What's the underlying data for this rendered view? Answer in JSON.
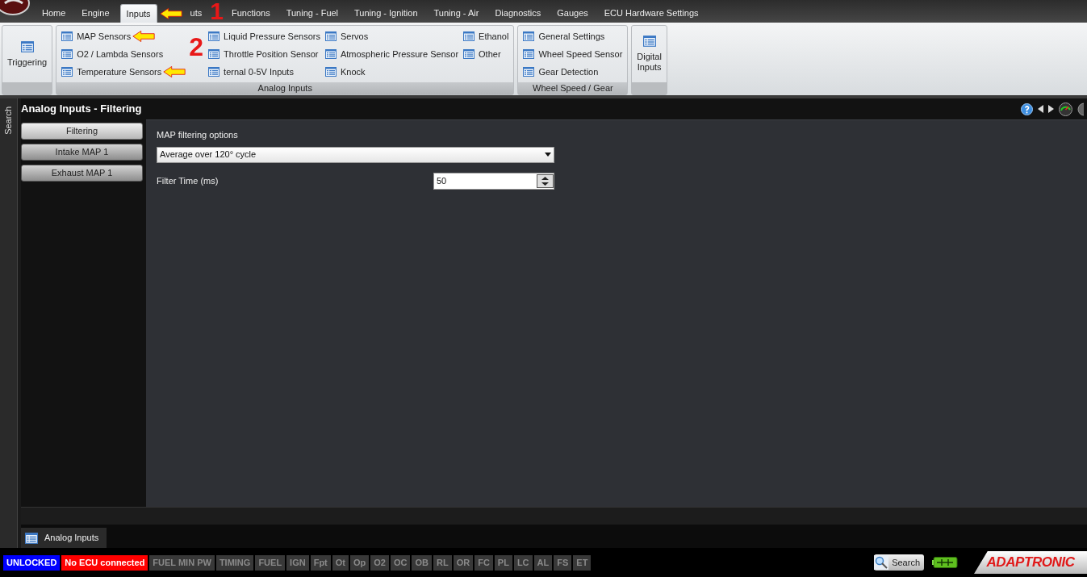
{
  "menu_tabs": [
    {
      "label": "Home",
      "selected": false
    },
    {
      "label": "Engine",
      "selected": false
    },
    {
      "label": "Inputs",
      "selected": true
    },
    {
      "label": "uts",
      "selected": false,
      "annotation": "1"
    },
    {
      "label": "Functions",
      "selected": false
    },
    {
      "label": "Tuning - Fuel",
      "selected": false
    },
    {
      "label": "Tuning - Ignition",
      "selected": false
    },
    {
      "label": "Tuning - Air",
      "selected": false
    },
    {
      "label": "Diagnostics",
      "selected": false
    },
    {
      "label": "Gauges",
      "selected": false
    },
    {
      "label": "ECU Hardware Settings",
      "selected": false
    }
  ],
  "ribbon": [
    {
      "kind": "large",
      "items": [
        {
          "label": "Triggering"
        }
      ]
    },
    {
      "kind": "columns",
      "title": "Analog Inputs",
      "columns": [
        {
          "annotation": "2",
          "items": [
            {
              "label": "MAP Sensors",
              "arrow": true
            },
            {
              "label": "O2 / Lambda Sensors",
              "arrow": false
            },
            {
              "label": "Temperature Sensors",
              "arrow": true
            }
          ]
        },
        {
          "items": [
            {
              "label": "Liquid Pressure Sensors",
              "arrow": false
            },
            {
              "label": "Throttle Position Sensor",
              "arrow": false
            },
            {
              "label": "ternal 0-5V Inputs",
              "arrow": false
            }
          ]
        },
        {
          "items": [
            {
              "label": "Servos",
              "arrow": false
            },
            {
              "label": "Atmospheric Pressure Sensor",
              "arrow": false
            },
            {
              "label": "Knock",
              "arrow": false
            }
          ]
        },
        {
          "items": [
            {
              "label": "Ethanol",
              "arrow": false
            },
            {
              "label": "Other",
              "arrow": false
            }
          ]
        }
      ]
    },
    {
      "kind": "columns",
      "title": "Wheel Speed / Gear",
      "columns": [
        {
          "items": [
            {
              "label": "General Settings",
              "arrow": false
            },
            {
              "label": "Wheel Speed Sensor",
              "arrow": false
            },
            {
              "label": "Gear Detection",
              "arrow": false
            }
          ]
        }
      ]
    },
    {
      "kind": "large",
      "items": [
        {
          "label": "Digital\nInputs"
        }
      ]
    }
  ],
  "side_tab": "Search",
  "page": {
    "title": "Analog Inputs - Filtering",
    "nav": [
      {
        "label": "Filtering",
        "selected": true
      },
      {
        "label": "Intake MAP 1",
        "selected": false
      },
      {
        "label": "Exhaust MAP 1",
        "selected": false
      }
    ],
    "fields": [
      {
        "kind": "select",
        "label": "MAP filtering options",
        "value": "Average over 120° cycle"
      },
      {
        "kind": "spin",
        "label": "Filter Time (ms)",
        "value": "50"
      }
    ]
  },
  "doc_tab": "Analog Inputs",
  "status_bar": {
    "indicators": [
      {
        "label": "UNLOCKED",
        "color": "#0000ff"
      },
      {
        "label": "No ECU connected",
        "color": "#ff0000"
      },
      {
        "label": "FUEL MIN PW",
        "color": "#383838"
      },
      {
        "label": "TIMING",
        "color": "#383838"
      },
      {
        "label": "FUEL",
        "color": "#383838"
      },
      {
        "label": "IGN",
        "color": "#383838"
      },
      {
        "label": "Fpt",
        "color": "#383838"
      },
      {
        "label": "Ot",
        "color": "#383838"
      },
      {
        "label": "Op",
        "color": "#383838"
      },
      {
        "label": "O2",
        "color": "#383838"
      },
      {
        "label": "OC",
        "color": "#383838"
      },
      {
        "label": "OB",
        "color": "#383838"
      },
      {
        "label": "RL",
        "color": "#383838"
      },
      {
        "label": "OR",
        "color": "#383838"
      },
      {
        "label": "FC",
        "color": "#383838"
      },
      {
        "label": "PL",
        "color": "#383838"
      },
      {
        "label": "LC",
        "color": "#383838"
      },
      {
        "label": "AL",
        "color": "#383838"
      },
      {
        "label": "FS",
        "color": "#383838"
      },
      {
        "label": "ET",
        "color": "#383838"
      }
    ],
    "search_button": "Search",
    "brand": "ADAPTRONIC"
  }
}
